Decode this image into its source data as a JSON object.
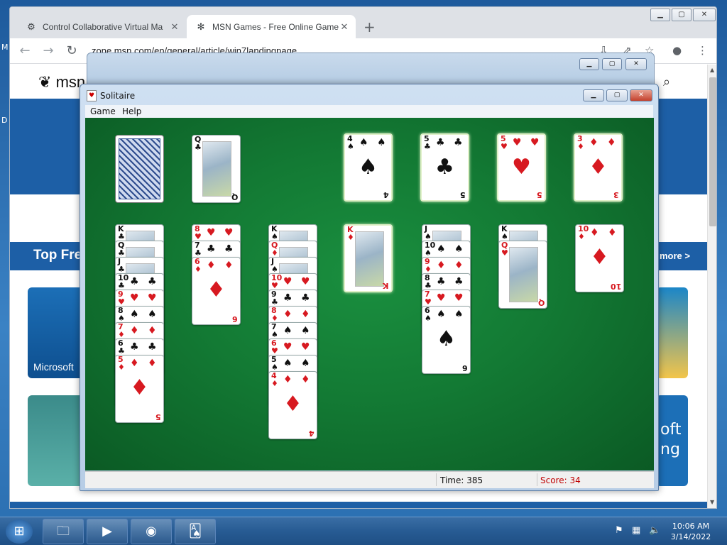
{
  "desktop": {
    "frag1": "M",
    "frag2": "D"
  },
  "browser": {
    "tabs": [
      {
        "icon": "vm-icon",
        "label": "Control Collaborative Virtual Ma",
        "close": "✕"
      },
      {
        "icon": "msn-icon",
        "label": "MSN Games - Free Online Game",
        "close": "✕"
      }
    ],
    "new_tab": "+",
    "url": "zone.msn.com/en/general/article/win7landingpage",
    "page": {
      "logo": "msn",
      "section_title": "Top Fre",
      "more_link": "more >",
      "thumb1_caption": "Microsoft",
      "right_frag1": "oft",
      "right_frag2": "ng"
    }
  },
  "solitaire": {
    "title": "Solitaire",
    "menus": [
      "Game",
      "Help"
    ],
    "time_label": "Time:  385",
    "score_label": "Score: 34"
  },
  "cards": {
    "waste": {
      "rank": "Q",
      "suit": "♣"
    },
    "foundations": [
      {
        "rank": "4",
        "suit": "♠"
      },
      {
        "rank": "5",
        "suit": "♣"
      },
      {
        "rank": "5",
        "suit": "♥"
      },
      {
        "rank": "3",
        "suit": "♦"
      }
    ],
    "tableau": [
      [
        {
          "rank": "K",
          "suit": "♣"
        },
        {
          "rank": "Q",
          "suit": "♣"
        },
        {
          "rank": "J",
          "suit": "♣"
        },
        {
          "rank": "10",
          "suit": "♣"
        },
        {
          "rank": "9",
          "suit": "♥"
        },
        {
          "rank": "8",
          "suit": "♠"
        },
        {
          "rank": "7",
          "suit": "♦"
        },
        {
          "rank": "6",
          "suit": "♣"
        },
        {
          "rank": "5",
          "suit": "♦"
        }
      ],
      [
        {
          "rank": "8",
          "suit": "♥"
        },
        {
          "rank": "7",
          "suit": "♣"
        },
        {
          "rank": "6",
          "suit": "♦"
        }
      ],
      [
        {
          "rank": "K",
          "suit": "♠"
        },
        {
          "rank": "Q",
          "suit": "♦"
        },
        {
          "rank": "J",
          "suit": "♠"
        },
        {
          "rank": "10",
          "suit": "♥"
        },
        {
          "rank": "9",
          "suit": "♣"
        },
        {
          "rank": "8",
          "suit": "♦"
        },
        {
          "rank": "7",
          "suit": "♠"
        },
        {
          "rank": "6",
          "suit": "♥"
        },
        {
          "rank": "5",
          "suit": "♠"
        },
        {
          "rank": "4",
          "suit": "♦"
        }
      ],
      [
        {
          "rank": "K",
          "suit": "♦"
        }
      ],
      [
        {
          "rank": "J",
          "suit": "♠"
        },
        {
          "rank": "10",
          "suit": "♠"
        },
        {
          "rank": "9",
          "suit": "♦"
        },
        {
          "rank": "8",
          "suit": "♣"
        },
        {
          "rank": "7",
          "suit": "♥"
        },
        {
          "rank": "6",
          "suit": "♠"
        }
      ],
      [
        {
          "rank": "K",
          "suit": "♠"
        },
        {
          "rank": "Q",
          "suit": "♥"
        }
      ],
      [
        {
          "rank": "10",
          "suit": "♦"
        }
      ]
    ]
  },
  "taskbar": {
    "time": "10:06 AM",
    "date": "3/14/2022"
  }
}
